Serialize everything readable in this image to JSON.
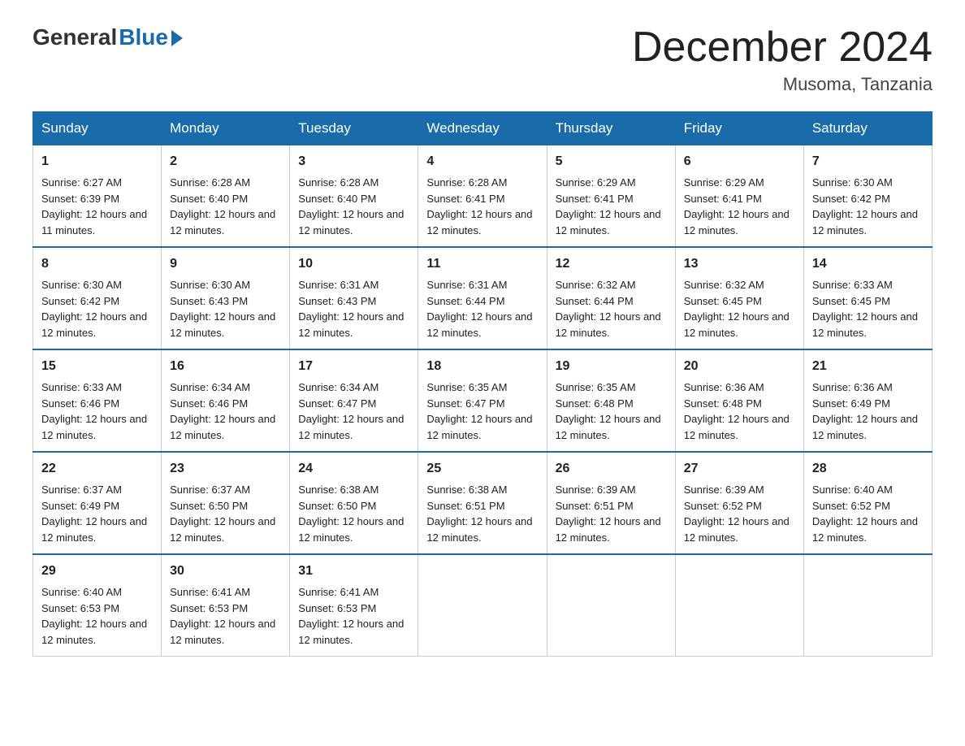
{
  "header": {
    "logo_general": "General",
    "logo_blue": "Blue",
    "month_title": "December 2024",
    "location": "Musoma, Tanzania"
  },
  "days_of_week": [
    "Sunday",
    "Monday",
    "Tuesday",
    "Wednesday",
    "Thursday",
    "Friday",
    "Saturday"
  ],
  "weeks": [
    [
      {
        "day": "1",
        "sunrise": "6:27 AM",
        "sunset": "6:39 PM",
        "daylight": "12 hours and 11 minutes."
      },
      {
        "day": "2",
        "sunrise": "6:28 AM",
        "sunset": "6:40 PM",
        "daylight": "12 hours and 12 minutes."
      },
      {
        "day": "3",
        "sunrise": "6:28 AM",
        "sunset": "6:40 PM",
        "daylight": "12 hours and 12 minutes."
      },
      {
        "day": "4",
        "sunrise": "6:28 AM",
        "sunset": "6:41 PM",
        "daylight": "12 hours and 12 minutes."
      },
      {
        "day": "5",
        "sunrise": "6:29 AM",
        "sunset": "6:41 PM",
        "daylight": "12 hours and 12 minutes."
      },
      {
        "day": "6",
        "sunrise": "6:29 AM",
        "sunset": "6:41 PM",
        "daylight": "12 hours and 12 minutes."
      },
      {
        "day": "7",
        "sunrise": "6:30 AM",
        "sunset": "6:42 PM",
        "daylight": "12 hours and 12 minutes."
      }
    ],
    [
      {
        "day": "8",
        "sunrise": "6:30 AM",
        "sunset": "6:42 PM",
        "daylight": "12 hours and 12 minutes."
      },
      {
        "day": "9",
        "sunrise": "6:30 AM",
        "sunset": "6:43 PM",
        "daylight": "12 hours and 12 minutes."
      },
      {
        "day": "10",
        "sunrise": "6:31 AM",
        "sunset": "6:43 PM",
        "daylight": "12 hours and 12 minutes."
      },
      {
        "day": "11",
        "sunrise": "6:31 AM",
        "sunset": "6:44 PM",
        "daylight": "12 hours and 12 minutes."
      },
      {
        "day": "12",
        "sunrise": "6:32 AM",
        "sunset": "6:44 PM",
        "daylight": "12 hours and 12 minutes."
      },
      {
        "day": "13",
        "sunrise": "6:32 AM",
        "sunset": "6:45 PM",
        "daylight": "12 hours and 12 minutes."
      },
      {
        "day": "14",
        "sunrise": "6:33 AM",
        "sunset": "6:45 PM",
        "daylight": "12 hours and 12 minutes."
      }
    ],
    [
      {
        "day": "15",
        "sunrise": "6:33 AM",
        "sunset": "6:46 PM",
        "daylight": "12 hours and 12 minutes."
      },
      {
        "day": "16",
        "sunrise": "6:34 AM",
        "sunset": "6:46 PM",
        "daylight": "12 hours and 12 minutes."
      },
      {
        "day": "17",
        "sunrise": "6:34 AM",
        "sunset": "6:47 PM",
        "daylight": "12 hours and 12 minutes."
      },
      {
        "day": "18",
        "sunrise": "6:35 AM",
        "sunset": "6:47 PM",
        "daylight": "12 hours and 12 minutes."
      },
      {
        "day": "19",
        "sunrise": "6:35 AM",
        "sunset": "6:48 PM",
        "daylight": "12 hours and 12 minutes."
      },
      {
        "day": "20",
        "sunrise": "6:36 AM",
        "sunset": "6:48 PM",
        "daylight": "12 hours and 12 minutes."
      },
      {
        "day": "21",
        "sunrise": "6:36 AM",
        "sunset": "6:49 PM",
        "daylight": "12 hours and 12 minutes."
      }
    ],
    [
      {
        "day": "22",
        "sunrise": "6:37 AM",
        "sunset": "6:49 PM",
        "daylight": "12 hours and 12 minutes."
      },
      {
        "day": "23",
        "sunrise": "6:37 AM",
        "sunset": "6:50 PM",
        "daylight": "12 hours and 12 minutes."
      },
      {
        "day": "24",
        "sunrise": "6:38 AM",
        "sunset": "6:50 PM",
        "daylight": "12 hours and 12 minutes."
      },
      {
        "day": "25",
        "sunrise": "6:38 AM",
        "sunset": "6:51 PM",
        "daylight": "12 hours and 12 minutes."
      },
      {
        "day": "26",
        "sunrise": "6:39 AM",
        "sunset": "6:51 PM",
        "daylight": "12 hours and 12 minutes."
      },
      {
        "day": "27",
        "sunrise": "6:39 AM",
        "sunset": "6:52 PM",
        "daylight": "12 hours and 12 minutes."
      },
      {
        "day": "28",
        "sunrise": "6:40 AM",
        "sunset": "6:52 PM",
        "daylight": "12 hours and 12 minutes."
      }
    ],
    [
      {
        "day": "29",
        "sunrise": "6:40 AM",
        "sunset": "6:53 PM",
        "daylight": "12 hours and 12 minutes."
      },
      {
        "day": "30",
        "sunrise": "6:41 AM",
        "sunset": "6:53 PM",
        "daylight": "12 hours and 12 minutes."
      },
      {
        "day": "31",
        "sunrise": "6:41 AM",
        "sunset": "6:53 PM",
        "daylight": "12 hours and 12 minutes."
      },
      null,
      null,
      null,
      null
    ]
  ],
  "labels": {
    "sunrise": "Sunrise:",
    "sunset": "Sunset:",
    "daylight": "Daylight:"
  }
}
